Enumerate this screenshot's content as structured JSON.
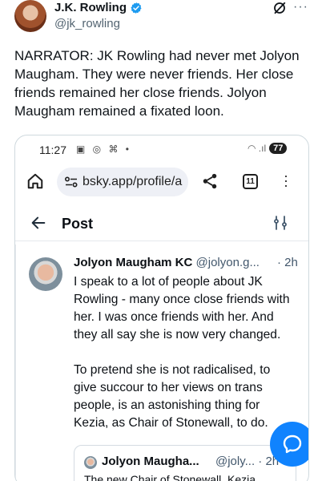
{
  "tweet": {
    "author_name": "J.K. Rowling",
    "author_handle": "@jk_rowling",
    "text": "NARRATOR: JK Rowling had never met Jolyon Maugham. They were never friends. Her close friends remained her close friends. Jolyon Maugham remained a fixated loon.",
    "more_label": "···"
  },
  "screenshot": {
    "status_bar": {
      "time": "11:27",
      "battery": "77"
    },
    "browser": {
      "url": "bsky.app/profile/a",
      "tab_count": "11"
    },
    "page_header": {
      "title": "Post"
    },
    "post": {
      "author": "Jolyon Maugham KC",
      "handle": "@jolyon.g...",
      "time": "· 2h",
      "paragraph_1": "I speak to a lot of people about JK Rowling - many once close friends with her. I was once friends with her. And they all say she is now very changed.",
      "paragraph_2": "To pretend she is not radicalised, to give succour to her views on trans people, is an astonishing thing for Kezia, as Chair of Stonewall, to do."
    },
    "quote": {
      "author": "Jolyon Maugha...",
      "handle": "@joly... · 2h",
      "text": "The new Chair of Stonewall, Kezia"
    }
  },
  "colors": {
    "verified_blue": "#1d9bf0",
    "fab_blue": "#1083fe"
  }
}
